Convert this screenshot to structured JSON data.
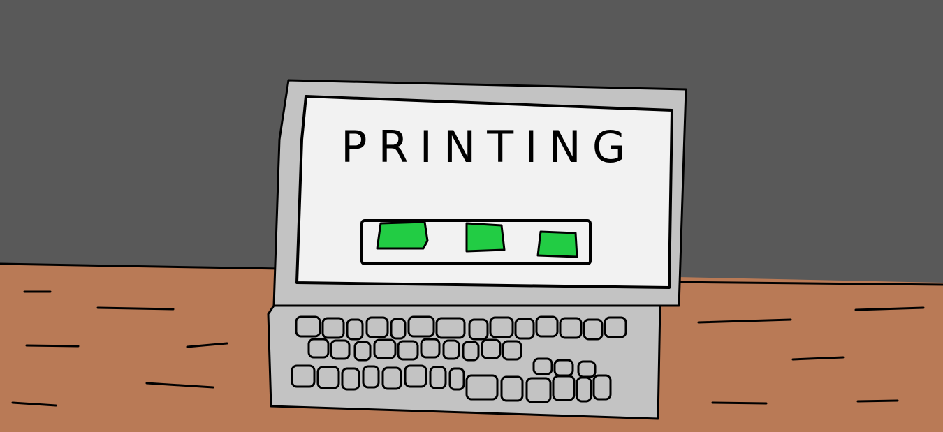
{
  "screen": {
    "text": "PRINTING"
  },
  "progress": {
    "fraction": 1.0,
    "blocks": 3,
    "color": "#22cc44"
  },
  "colors": {
    "wall": "#595959",
    "desk": "#b97a56",
    "laptop_body": "#c3c3c3",
    "screen": "#f2f2f2",
    "outline": "#000000"
  }
}
